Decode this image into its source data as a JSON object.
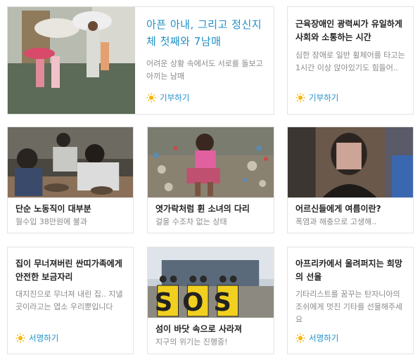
{
  "colors": {
    "accent": "#1e8fc6",
    "title": "#222222",
    "desc": "#8a8a8a",
    "sun": "#f5b400"
  },
  "cards": [
    {
      "title": "아픈 아내, 그리고 정신지체 첫째와 7남매",
      "desc": "어려운 상황 속에서도 서로를 돌보고 아끼는 남매",
      "action": "기부하기",
      "icon": "sun-icon"
    },
    {
      "title": "근육장애인 광력씨가 유일하게 사회와 소통하는 시간",
      "desc": "심한 장애로 일반 휠체어를 타고는 1시간 이상 앉아있기도 힘들어..",
      "action": "기부하기",
      "icon": "sun-icon"
    },
    {
      "title": "단순 노동직이 대부분",
      "desc": "월수입 38만원에 불과"
    },
    {
      "title": "엿가락처럼 휜 소녀의 다리",
      "desc": "걸을 수조차 없는 상태"
    },
    {
      "title": "어르신들에게 여름이란?",
      "desc": "폭염과 해충으로 고생해.."
    },
    {
      "title": "집이 무너져버린 싼띠가족에게 안전한 보금자리",
      "desc": "대지진으로 무너져 내린 집.. 지낼 곳이라고는 엽소 우리뿐입니다",
      "action": "서명하기",
      "icon": "sun-icon"
    },
    {
      "title": "섬이 바닷 속으로 사라져",
      "desc": "지구의 위기는 진행중!",
      "sign_text": "SOS"
    },
    {
      "title": "아프리카에서 울려퍼지는 희망의 선율",
      "desc": "기타리스트를 꿈꾸는 탄자니아의 조쉬에게 멋진 기타를 선물해주세요",
      "action": "서명하기",
      "icon": "sun-icon"
    }
  ]
}
